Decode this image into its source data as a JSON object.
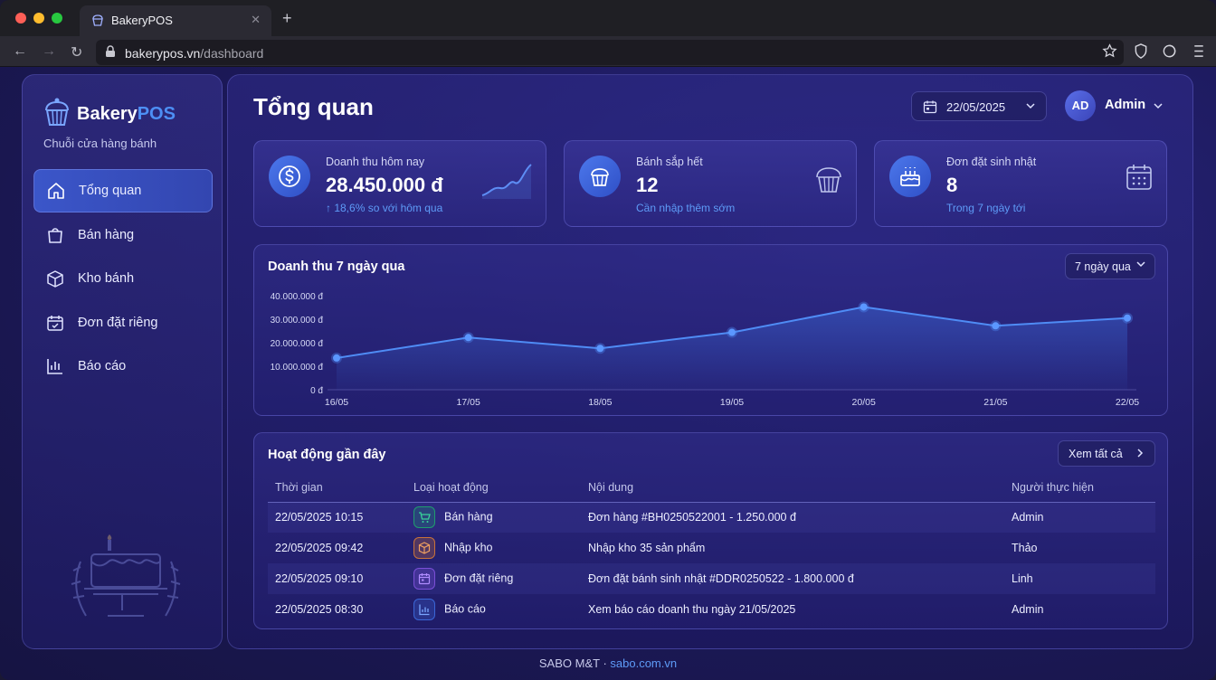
{
  "browser": {
    "tab_title": "BakeryPOS",
    "url_domain": "bakerypos.vn",
    "url_path": "/dashboard"
  },
  "sidebar": {
    "brand_a": "Bakery",
    "brand_b": "POS",
    "subtitle": "Chuỗi cửa hàng bánh",
    "items": [
      {
        "label": "Tổng quan",
        "icon": "home-icon",
        "active": true
      },
      {
        "label": "Bán hàng",
        "icon": "shopping-bag-icon",
        "active": false
      },
      {
        "label": "Kho bánh",
        "icon": "box-icon",
        "active": false
      },
      {
        "label": "Đơn đặt riêng",
        "icon": "calendar-icon",
        "active": false
      },
      {
        "label": "Báo cáo",
        "icon": "bar-chart-icon",
        "active": false
      }
    ]
  },
  "header": {
    "title": "Tổng quan",
    "date": "22/05/2025",
    "avatar_initials": "AD",
    "user_name": "Admin"
  },
  "stats": [
    {
      "label": "Doanh thu hôm nay",
      "value": "28.450.000 đ",
      "sub": "↑ 18,6% so với hôm qua",
      "icon": "dollar-icon"
    },
    {
      "label": "Bánh sắp hết",
      "value": "12",
      "sub": "Cần nhập thêm sớm",
      "icon": "cupcake-icon"
    },
    {
      "label": "Đơn đặt sinh nhật",
      "value": "8",
      "sub": "Trong 7 ngày tới",
      "icon": "birthday-cake-icon"
    }
  ],
  "revenue_chart": {
    "title": "Doanh thu 7 ngày qua",
    "range_label": "7 ngày qua"
  },
  "chart_data": {
    "type": "area",
    "title": "Doanh thu 7 ngày qua",
    "x": [
      "16/05",
      "17/05",
      "18/05",
      "19/05",
      "20/05",
      "21/05",
      "22/05"
    ],
    "y_ticks": [
      "0 đ",
      "10.000.000 đ",
      "20.000.000 đ",
      "30.000.000 đ",
      "40.000.000 đ"
    ],
    "ylim": [
      0,
      40000000
    ],
    "series": [
      {
        "values": [
          13500000,
          22200000,
          17600000,
          24400000,
          35200000,
          27200000,
          30500000
        ]
      }
    ],
    "grid": false
  },
  "activity": {
    "title": "Hoạt động gần đây",
    "see_all": "Xem tất cả",
    "columns": [
      "Thời gian",
      "Loại hoạt động",
      "Nội dung",
      "Người thực hiện"
    ],
    "rows": [
      {
        "time": "22/05/2025 10:15",
        "type": "Bán hàng",
        "type_icon": "cart-icon",
        "type_color": "#1f9d6e",
        "content": "Đơn hàng #BH0250522001 - 1.250.000 đ",
        "user": "Admin"
      },
      {
        "time": "22/05/2025 09:42",
        "type": "Nhập kho",
        "type_icon": "package-icon",
        "type_color": "#c9733a",
        "content": "Nhập kho 35 sản phẩm",
        "user": "Thảo"
      },
      {
        "time": "22/05/2025 09:10",
        "type": "Đơn đặt riêng",
        "type_icon": "calendar-icon",
        "type_color": "#7a4fd6",
        "content": "Đơn đặt bánh sinh nhật #DDR0250522 - 1.800.000 đ",
        "user": "Linh"
      },
      {
        "time": "22/05/2025 08:30",
        "type": "Báo cáo",
        "type_icon": "report-icon",
        "type_color": "#3a66d6",
        "content": "Xem báo cáo doanh thu ngày 21/05/2025",
        "user": "Admin"
      }
    ]
  },
  "footer": {
    "company": "SABO M&T · ",
    "site": "sabo.com.vn"
  },
  "colors": {
    "accent": "#4d8ff5",
    "line": "#4f8cf5"
  }
}
